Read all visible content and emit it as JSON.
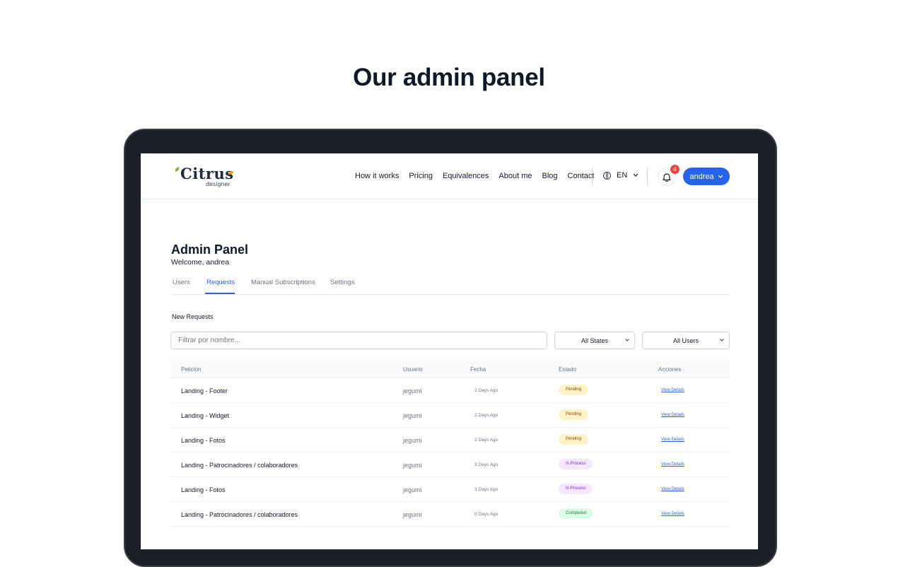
{
  "hero": {
    "title": "Our admin panel"
  },
  "logo": {
    "word": "Citrus",
    "sub": "designer"
  },
  "nav": {
    "links": [
      "How it works",
      "Pricing",
      "Equivalences",
      "About me",
      "Blog",
      "Contact"
    ],
    "language": "EN",
    "notifications_count": "4",
    "user": "andrea"
  },
  "page": {
    "title": "Admin Panel",
    "welcome": "Welcome, andrea",
    "tabs": [
      "Users",
      "Requests",
      "Manual Subscriptions",
      "Settings"
    ],
    "active_tab": "Requests",
    "section_label": "New Requests"
  },
  "filters": {
    "name_placeholder": "Filtrar por nombre...",
    "state_selected": "All States",
    "user_selected": "All Users"
  },
  "table": {
    "headers": [
      "Petición",
      "Usuario",
      "Fecha",
      "Estado",
      "Acciones"
    ],
    "rows": [
      {
        "peticion": "Landing - Footer",
        "usuario": "jegumi",
        "fecha": "2 Days Ago",
        "estado": "Pending",
        "accion": "View Details"
      },
      {
        "peticion": "Landing - Widget",
        "usuario": "jegumi",
        "fecha": "2 Days Ago",
        "estado": "Pending",
        "accion": "View Details"
      },
      {
        "peticion": "Landing - Fotos",
        "usuario": "jegumi",
        "fecha": "2 Days Ago",
        "estado": "Pending",
        "accion": "View Details"
      },
      {
        "peticion": "Landing - Patrocinadores / colaboradores",
        "usuario": "jegumi",
        "fecha": "3 Days Ago",
        "estado": "In Process",
        "accion": "View Details"
      },
      {
        "peticion": "Landing - Fotos",
        "usuario": "jegumi",
        "fecha": "3 Days Ago",
        "estado": "In Process",
        "accion": "View Details"
      },
      {
        "peticion": "Landing - Patrocinadores / colaboradores",
        "usuario": "jegumi",
        "fecha": "5 Days Ago",
        "estado": "Completed",
        "accion": "View Details"
      }
    ]
  },
  "colors": {
    "accent": "#2563eb",
    "pending_bg": "#fef3c7",
    "in_process_bg": "#f3e8ff",
    "completed_bg": "#dcfce7",
    "badge": "#ef4444"
  }
}
